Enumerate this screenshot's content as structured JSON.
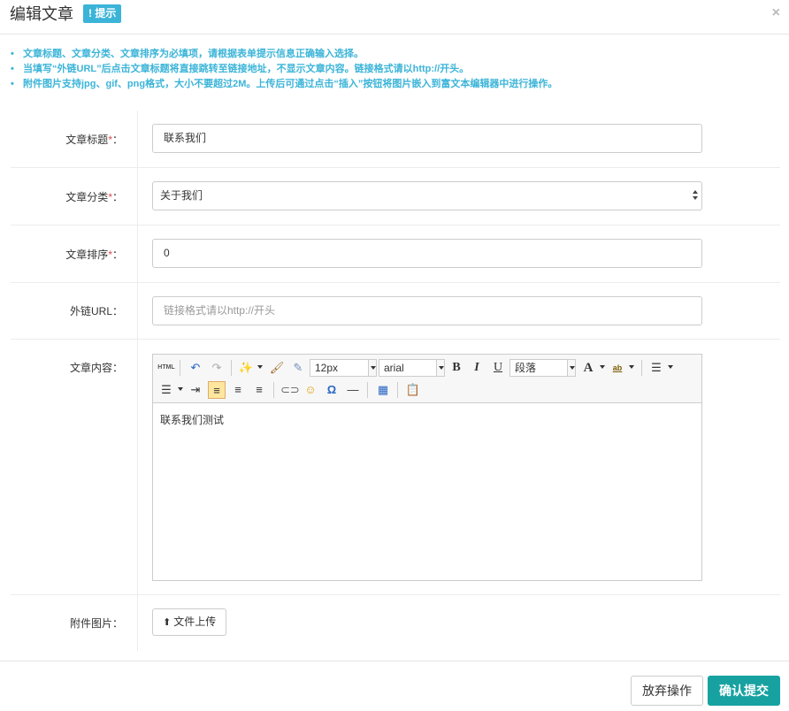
{
  "header": {
    "title": "编辑文章",
    "tip_badge": "! 提示",
    "close": "×"
  },
  "tips": [
    "文章标题、文章分类、文章排序为必填项，请根据表单提示信息正确输入选择。",
    "当填写“外链URL”后点击文章标题将直接跳转至链接地址，不显示文章内容。链接格式请以http://开头。",
    "附件图片支持jpg、gif、png格式，大小不要超过2M。上传后可通过点击“插入”按钮将图片嵌入到富文本编辑器中进行操作。"
  ],
  "form": {
    "title_label": "文章标题",
    "title_value": "联系我们",
    "category_label": "文章分类",
    "category_value": "关于我们",
    "sort_label": "文章排序",
    "sort_value": "0",
    "url_label": "外链URL：",
    "url_placeholder": "链接格式请以http://开头",
    "content_label": "文章内容：",
    "attachment_label": "附件图片：",
    "upload_label": "文件上传",
    "required_mark": "*",
    "colon": "："
  },
  "editor": {
    "html_btn": "HTML",
    "font_size": "12px",
    "font_family": "arial",
    "paragraph": "段落",
    "bold": "B",
    "italic": "I",
    "underline": "U",
    "font_color": "A",
    "highlight": "ab",
    "omega": "Ω",
    "hr": "—",
    "content": "联系我们测试"
  },
  "footer": {
    "cancel": "放弃操作",
    "submit": "确认提交"
  }
}
